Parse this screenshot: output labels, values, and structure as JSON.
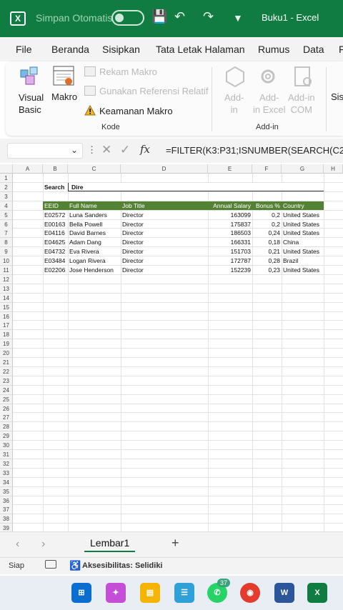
{
  "titlebar": {
    "autosave_label": "Simpan Otomatis",
    "doc_title": "Buku1 - Excel"
  },
  "menu": {
    "items": [
      "File",
      "Beranda",
      "Sisipkan",
      "Tata Letak Halaman",
      "Rumus",
      "Data",
      "F"
    ]
  },
  "ribbon": {
    "visual_basic": "Visual\nBasic",
    "macros": "Makro",
    "record_macro": "Rekam Makro",
    "relative_ref": "Gunakan Referensi Relatif",
    "macro_security": "Keamanan Makro",
    "group_code": "Kode",
    "addin": "Add-\nin",
    "addin_excel": "Add-\nin Excel",
    "addin_com": "Add-in\nCOM",
    "group_addins": "Add-in",
    "sis": "Sisi"
  },
  "formula_bar": {
    "fx": "fx",
    "formula": "=FILTER(K3:P31;ISNUMBER(SEARCH(C2"
  },
  "sheet": {
    "columns": [
      "A",
      "B",
      "C",
      "D",
      "E",
      "F",
      "G",
      "H"
    ],
    "rows": [
      "1",
      "2",
      "3",
      "4",
      "5",
      "6",
      "7",
      "8",
      "9",
      "10",
      "11",
      "12",
      "13",
      "14",
      "15",
      "16",
      "17",
      "18",
      "19",
      "20",
      "21",
      "22",
      "23",
      "24",
      "25",
      "26",
      "27",
      "28",
      "29",
      "30",
      "31",
      "32",
      "33",
      "34",
      "35",
      "36",
      "37",
      "38",
      "39"
    ],
    "search_label": "Search",
    "search_value": "Dire",
    "headers": [
      "EEID",
      "Full Name",
      "Job Title",
      "Annual Salary",
      "Bonus %",
      "Country"
    ],
    "data": [
      [
        "E02572",
        "Luna Sanders",
        "Director",
        "163099",
        "0,2",
        "United States"
      ],
      [
        "E00163",
        "Bella Powell",
        "Director",
        "175837",
        "0,2",
        "United States"
      ],
      [
        "E04116",
        "David Barnes",
        "Director",
        "186503",
        "0,24",
        "United States"
      ],
      [
        "E04625",
        "Adam Dang",
        "Director",
        "166331",
        "0,18",
        "China"
      ],
      [
        "E04732",
        "Eva Rivera",
        "Director",
        "151703",
        "0,21",
        "United States"
      ],
      [
        "E03484",
        "Logan Rivera",
        "Director",
        "172787",
        "0,28",
        "Brazil"
      ],
      [
        "E02206",
        "Jose Henderson",
        "Director",
        "152239",
        "0,23",
        "United States"
      ]
    ]
  },
  "tabs": {
    "sheet1": "Lembar1",
    "add": "+"
  },
  "status": {
    "ready": "Siap",
    "accessibility": "Aksesibilitas: Selidiki"
  },
  "taskbar": {
    "whatsapp_badge": "37"
  },
  "colors": {
    "excel_green": "#107c41",
    "table_header": "#548235"
  }
}
